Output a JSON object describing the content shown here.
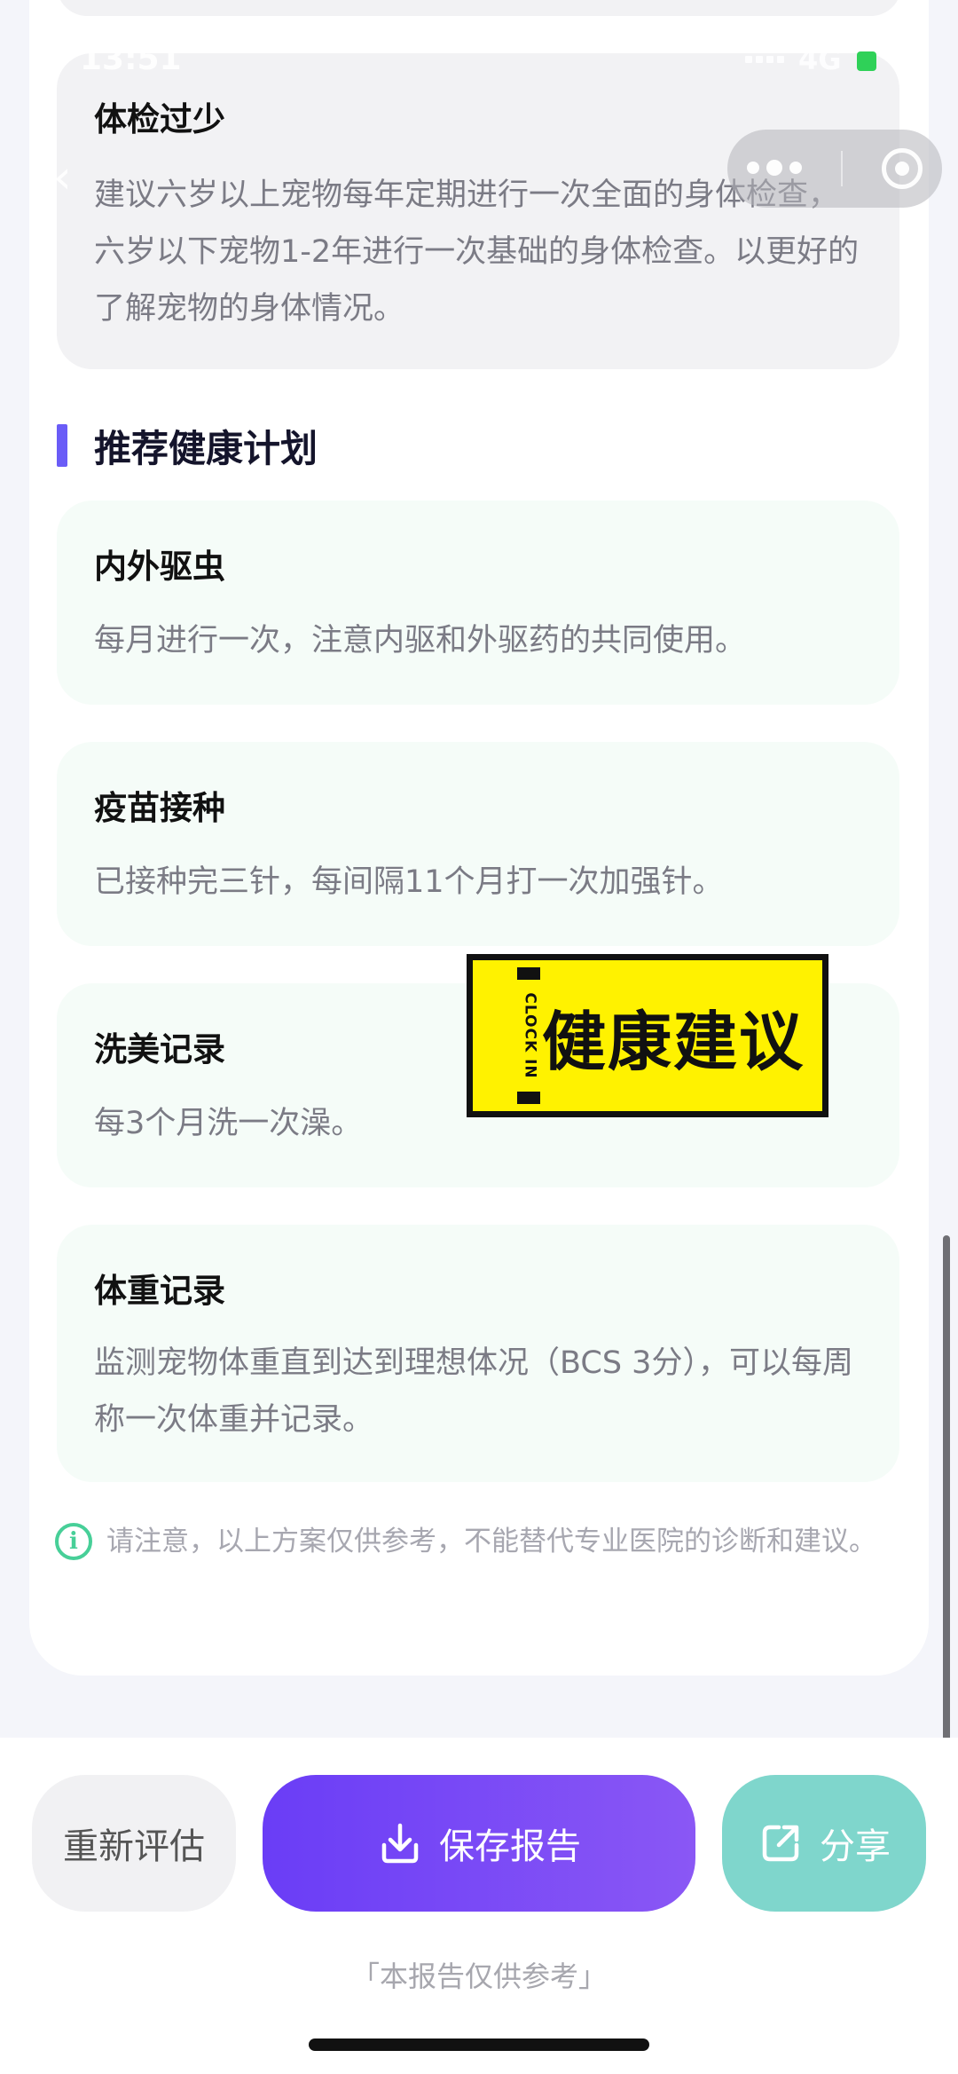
{
  "status_bar": {
    "time": "13:51",
    "network": "4G"
  },
  "cards_top": [
    {
      "title": "体检过少",
      "body": "建议六岁以上宠物每年定期进行一次全面的身体检查，六岁以下宠物1-2年进行一次基础的身体检查。以更好的了解宠物的身体情况。"
    }
  ],
  "section": {
    "title": "推荐健康计划"
  },
  "plans": [
    {
      "title": "内外驱虫",
      "body": "每月进行一次，注意内驱和外驱药的共同使用。"
    },
    {
      "title": "疫苗接种",
      "body": "已接种完三针，每间隔11个月打一次加强针。"
    },
    {
      "title": "洗美记录",
      "body": "每3个月洗一次澡。"
    },
    {
      "title": "体重记录",
      "body": "监测宠物体重直到达到理想体况（BCS 3分），可以每周称一次体重并记录。"
    }
  ],
  "sticker": {
    "side_text": "CLOCK IN",
    "main_text": "健康建议"
  },
  "notice": {
    "text": "请注意，以上方案仅供参考，不能替代专业医院的诊断和建议。"
  },
  "bottom_bar": {
    "reassess_label": "重新评估",
    "save_label": "保存报告",
    "share_label": "分享",
    "footnote": "「本报告仅供参考」"
  },
  "colors": {
    "accent_purple": "#6a5cf7",
    "accent_green": "#47cf98",
    "share_teal": "#7fd6cc"
  }
}
